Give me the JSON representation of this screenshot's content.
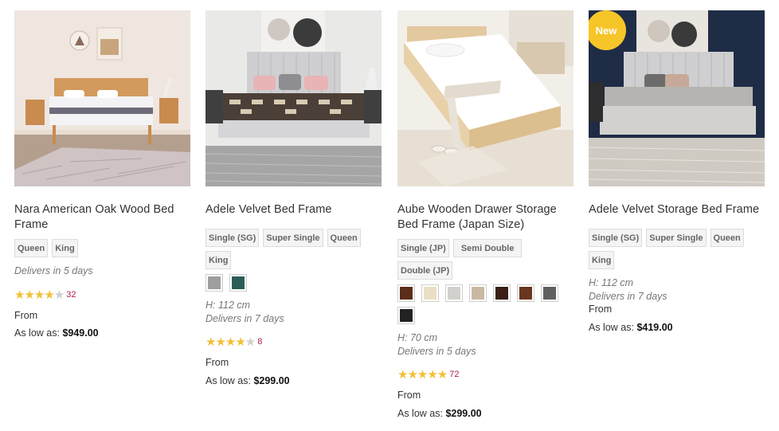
{
  "products": [
    {
      "title": "Nara American Oak Wood Bed Frame",
      "sizes": [
        "Queen",
        "King"
      ],
      "delivery": "Delivers in 5 days",
      "rating": 4.5,
      "review_count": "32",
      "from_label": "From",
      "price_prefix": "As low as:",
      "price": "$949.00"
    },
    {
      "title": "Adele Velvet Bed Frame",
      "sizes": [
        "Single (SG)",
        "Super Single",
        "Queen",
        "King"
      ],
      "colors": [
        "#9e9e9e",
        "#2c5d57"
      ],
      "height": "H: 112 cm",
      "delivery": "Delivers in 7 days",
      "rating": 4.5,
      "review_count": "8",
      "from_label": "From",
      "price_prefix": "As low as:",
      "price": "$299.00"
    },
    {
      "title": "Aube Wooden Drawer Storage Bed Frame (Japan Size)",
      "sizes": [
        "Single (JP)",
        "Semi Double",
        "Double (JP)"
      ],
      "colors": [
        "#5a2e1b",
        "#eadfc4",
        "#d2d0cc",
        "#c9b8a2",
        "#3a1f17",
        "#6b3620",
        "#606060",
        "#222222"
      ],
      "height": "H: 70 cm",
      "delivery": "Delivers in 5 days",
      "rating": 5,
      "review_count": "72",
      "from_label": "From",
      "price_prefix": "As low as:",
      "price": "$299.00"
    },
    {
      "badge": "New",
      "title": "Adele Velvet Storage Bed Frame",
      "sizes": [
        "Single (SG)",
        "Super Single",
        "Queen",
        "King"
      ],
      "height": "H: 112 cm",
      "delivery": "Delivers in 7 days",
      "from_label": "From",
      "price_prefix": "As low as:",
      "price": "$419.00"
    }
  ]
}
